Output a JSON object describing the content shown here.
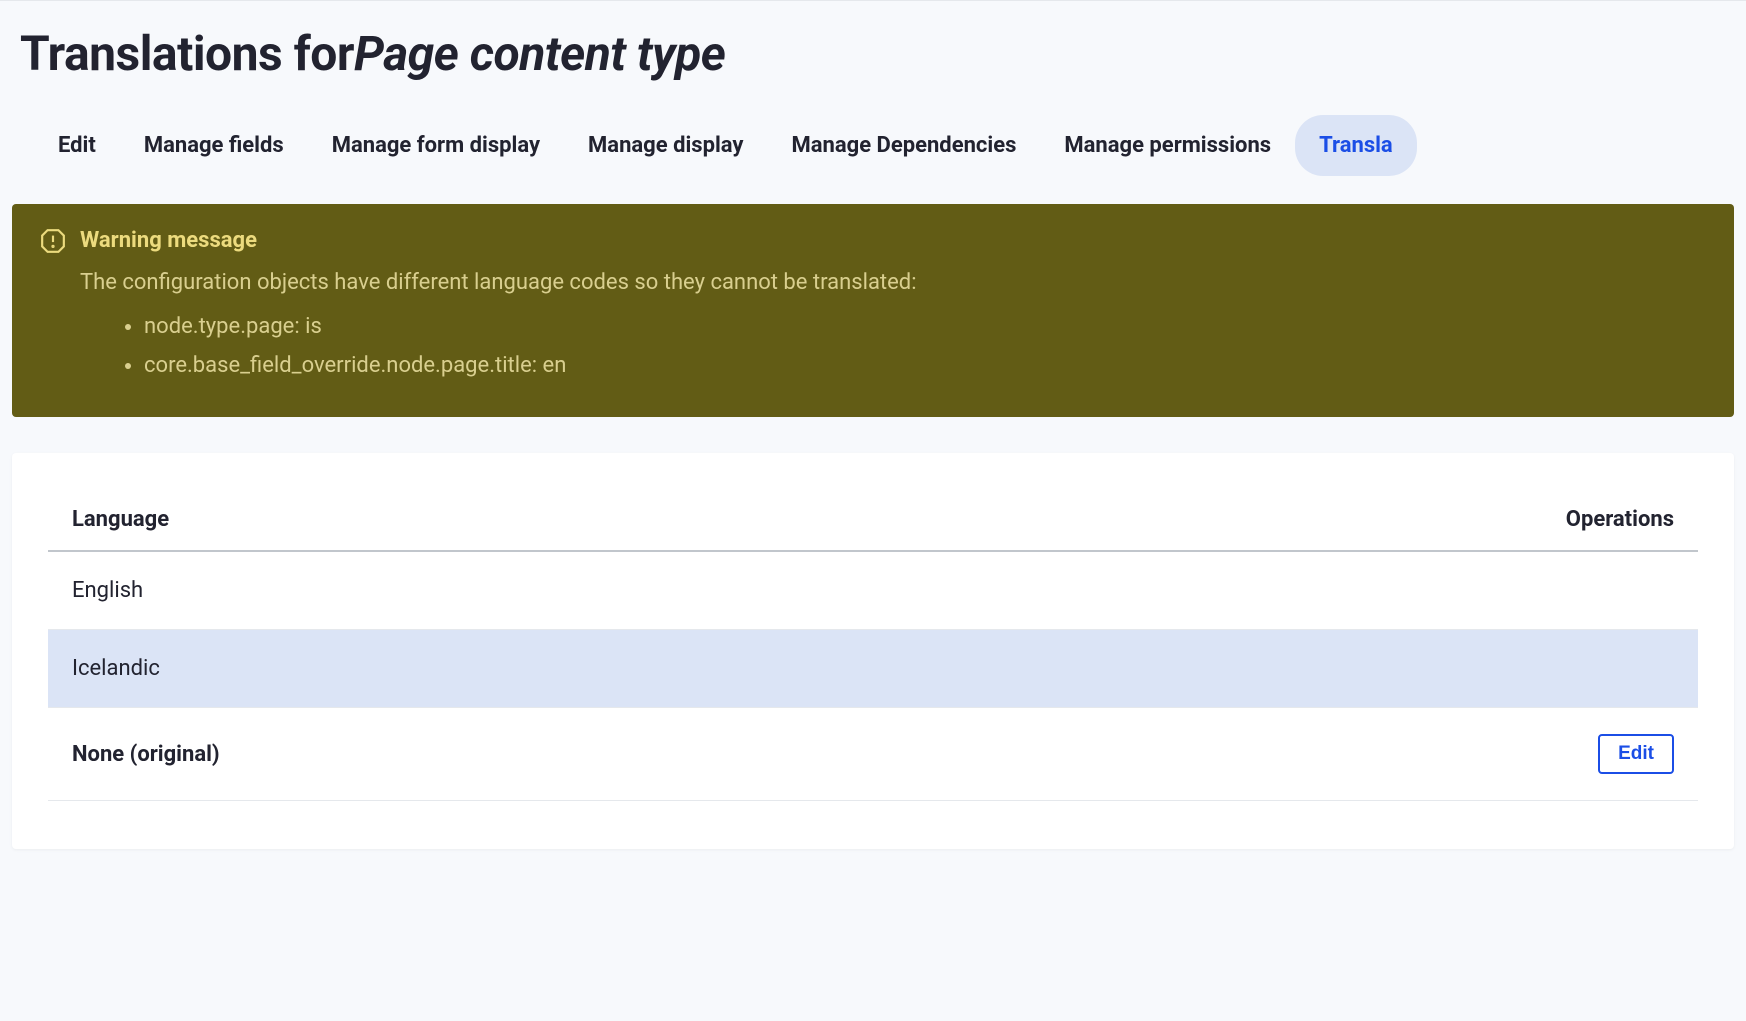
{
  "header": {
    "title_prefix": "Translations for",
    "title_italic": "Page content type"
  },
  "tabs": [
    {
      "label": "Edit",
      "active": false
    },
    {
      "label": "Manage fields",
      "active": false
    },
    {
      "label": "Manage form display",
      "active": false
    },
    {
      "label": "Manage display",
      "active": false
    },
    {
      "label": "Manage Dependencies",
      "active": false
    },
    {
      "label": "Manage permissions",
      "active": false
    },
    {
      "label": "Transla",
      "active": true
    }
  ],
  "warning": {
    "title": "Warning message",
    "body": "The configuration objects have different language codes so they cannot be translated:",
    "items": [
      "node.type.page: is",
      "core.base_field_override.node.page.title: en"
    ]
  },
  "table": {
    "headers": {
      "language": "Language",
      "operations": "Operations"
    },
    "rows": [
      {
        "language": "English",
        "bold": false,
        "highlighted": false,
        "operation": null
      },
      {
        "language": "Icelandic",
        "bold": false,
        "highlighted": true,
        "operation": null
      },
      {
        "language": "None (original)",
        "bold": true,
        "highlighted": false,
        "operation": "Edit"
      }
    ]
  }
}
